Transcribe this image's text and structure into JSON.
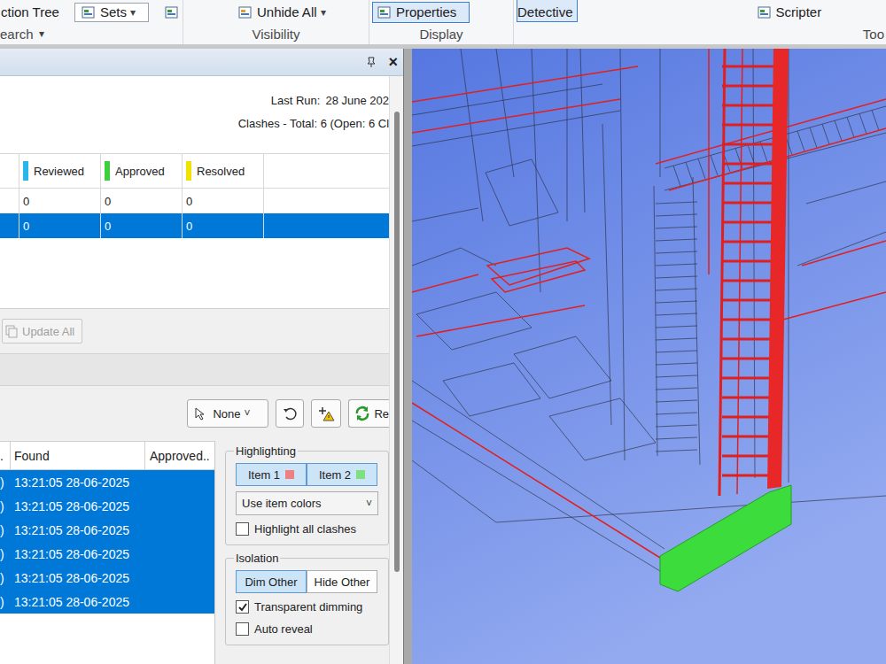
{
  "ribbon": {
    "groups": [
      {
        "label": "earch",
        "caret": "▾",
        "tools": [
          {
            "kind": "plain",
            "label": "ction Tree",
            "selected": false
          },
          {
            "kind": "box",
            "label": "Sets",
            "caret": "▾",
            "selected": false
          },
          {
            "kind": "icon",
            "selected": false
          }
        ]
      },
      {
        "label": "Visibility",
        "tools": [
          {
            "kind": "iconlabel",
            "label": "Unhide All",
            "caret": "▾",
            "selected": false
          }
        ]
      },
      {
        "label": "Display",
        "tools": [
          {
            "kind": "iconlabel",
            "label": "Properties",
            "selected": true
          }
        ]
      },
      {
        "label": "Too",
        "tools": [
          {
            "kind": "plain",
            "label": "Detective",
            "selected": true
          },
          {
            "kind": "iconlabel",
            "label": "Scripter",
            "selected": false
          }
        ]
      }
    ]
  },
  "panel": {
    "close": "×"
  },
  "summary": {
    "last_run_label": "Last Run:",
    "last_run": "28 June 202",
    "clashes": "Clashes -  Total:  6  (Open:  6  Cl"
  },
  "tests_table": {
    "columns": [
      {
        "label": "Reviewed",
        "color": "#29b6e8"
      },
      {
        "label": "Approved",
        "color": "#3cd13c"
      },
      {
        "label": "Resolved",
        "color": "#f2e200"
      }
    ],
    "rows": [
      {
        "cells": [
          "0",
          "0",
          "0"
        ],
        "selected": false
      },
      {
        "cells": [
          "0",
          "0",
          "0"
        ],
        "selected": true
      }
    ]
  },
  "update_all": {
    "label": "Update All",
    "disabled": true
  },
  "toolbar": {
    "select": {
      "label": "None",
      "caret": "˅"
    },
    "refresh": "Re"
  },
  "results": {
    "columns": [
      ".",
      "Found",
      "Approved.."
    ],
    "rows": [
      {
        "cells": [
          ")",
          "13:21:05 28-06-2025"
        ],
        "selected": true
      },
      {
        "cells": [
          ")",
          "13:21:05 28-06-2025"
        ],
        "selected": true
      },
      {
        "cells": [
          ")",
          "13:21:05 28-06-2025"
        ],
        "selected": true
      },
      {
        "cells": [
          ")",
          "13:21:05 28-06-2025"
        ],
        "selected": true
      },
      {
        "cells": [
          ")",
          "13:21:05 28-06-2025"
        ],
        "selected": true
      },
      {
        "cells": [
          ")",
          "13:21:05 28-06-2025"
        ],
        "selected": true
      }
    ]
  },
  "highlighting": {
    "title": "Highlighting",
    "items": [
      {
        "label": "Item 1",
        "color": "#f08080",
        "selected": true
      },
      {
        "label": "Item 2",
        "color": "#7ee07e",
        "selected": true
      }
    ],
    "mode": {
      "value": "Use item colors",
      "caret": "˅"
    },
    "options": [
      {
        "label": "Highlight all clashes",
        "checked": false
      }
    ]
  },
  "isolation": {
    "title": "Isolation",
    "modes": [
      {
        "label": "Dim Other",
        "selected": true
      },
      {
        "label": "Hide Other",
        "selected": false
      }
    ],
    "options": [
      {
        "label": "Transparent dimming",
        "checked": true
      },
      {
        "label": "Auto reveal",
        "checked": false
      }
    ]
  }
}
